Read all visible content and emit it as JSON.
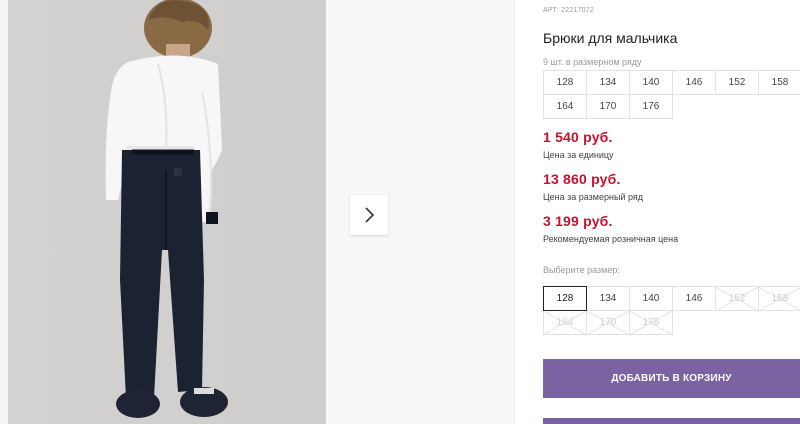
{
  "product": {
    "article": "АРТ: 22217072",
    "title": "Брюки для мальчика",
    "size_row_count": "9 шт. в размерном ряду",
    "size_row": [
      "128",
      "134",
      "140",
      "146",
      "152",
      "158",
      "164",
      "170",
      "176"
    ]
  },
  "prices": {
    "unit_price": "1 540 руб.",
    "unit_label": "Цена за единицу",
    "row_price": "13 860 руб.",
    "row_label": "Цена за размерный ряд",
    "retail_price": "3 199 руб.",
    "retail_label": "Рекомендуемая розничная цена"
  },
  "size_picker": {
    "label": "Выберите размер:",
    "sizes": [
      {
        "value": "128",
        "state": "selected"
      },
      {
        "value": "134",
        "state": "available"
      },
      {
        "value": "140",
        "state": "available"
      },
      {
        "value": "146",
        "state": "available"
      },
      {
        "value": "152",
        "state": "disabled"
      },
      {
        "value": "158",
        "state": "disabled"
      },
      {
        "value": "164",
        "state": "disabled"
      },
      {
        "value": "170",
        "state": "disabled"
      },
      {
        "value": "176",
        "state": "disabled"
      }
    ]
  },
  "actions": {
    "add_to_cart": "ДОБАВИТЬ В КОРЗИНУ"
  },
  "gallery": {
    "next_icon": "chevron-right-icon"
  },
  "colors": {
    "price_red": "#c8102e",
    "button_purple": "#7b62a3"
  }
}
